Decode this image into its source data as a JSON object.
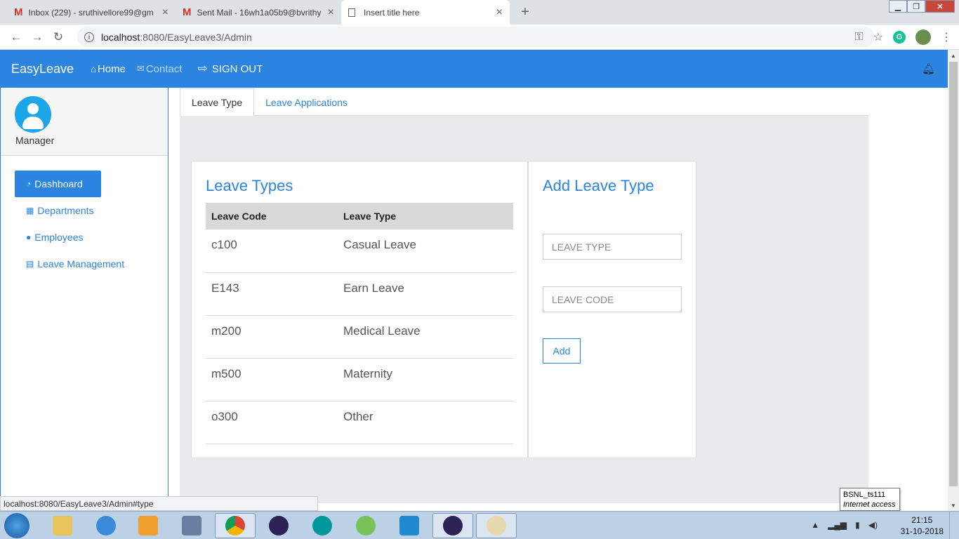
{
  "browser": {
    "tabs": [
      {
        "title": "Inbox (229) - sruthivellore99@gm",
        "icon": "gmail-icon"
      },
      {
        "title": "Sent Mail - 16wh1a05b9@bvrithy",
        "icon": "gmail-icon"
      },
      {
        "title": "Insert title here",
        "icon": "page-icon"
      }
    ],
    "url_host": "localhost",
    "url_path": ":8080/EasyLeave3/Admin",
    "status_url": "localhost:8080/EasyLeave3/Admin#type"
  },
  "navbar": {
    "brand": "EasyLeave",
    "home": "Home",
    "contact": "Contact",
    "signout": "SIGN OUT"
  },
  "sidebar": {
    "role": "Manager",
    "items": [
      {
        "label": "Dashboard",
        "icon": "dashboard-icon"
      },
      {
        "label": "Departments",
        "icon": "grid-icon"
      },
      {
        "label": "Employees",
        "icon": "user-icon"
      },
      {
        "label": "Leave Management",
        "icon": "calendar-icon"
      }
    ]
  },
  "tabs": [
    "Leave Type",
    "Leave Applications"
  ],
  "leave_types": {
    "title": "Leave Types",
    "headers": [
      "Leave Code",
      "Leave Type"
    ],
    "rows": [
      [
        "c100",
        "Casual Leave"
      ],
      [
        "E143",
        "Earn Leave"
      ],
      [
        "m200",
        "Medical Leave"
      ],
      [
        "m500",
        "Maternity"
      ],
      [
        "o300",
        "Other"
      ]
    ]
  },
  "add_form": {
    "title": "Add Leave Type",
    "type_placeholder": "LEAVE TYPE",
    "code_placeholder": "LEAVE CODE",
    "add_label": "Add"
  },
  "tray": {
    "network_name": "BSNL_ts111",
    "network_status": "Internet access",
    "time": "21:15",
    "date": "31-10-2018"
  },
  "colors": {
    "primary": "#2b84e0",
    "panel_bg": "#e8eaec",
    "table_header": "#d9d9d9"
  }
}
